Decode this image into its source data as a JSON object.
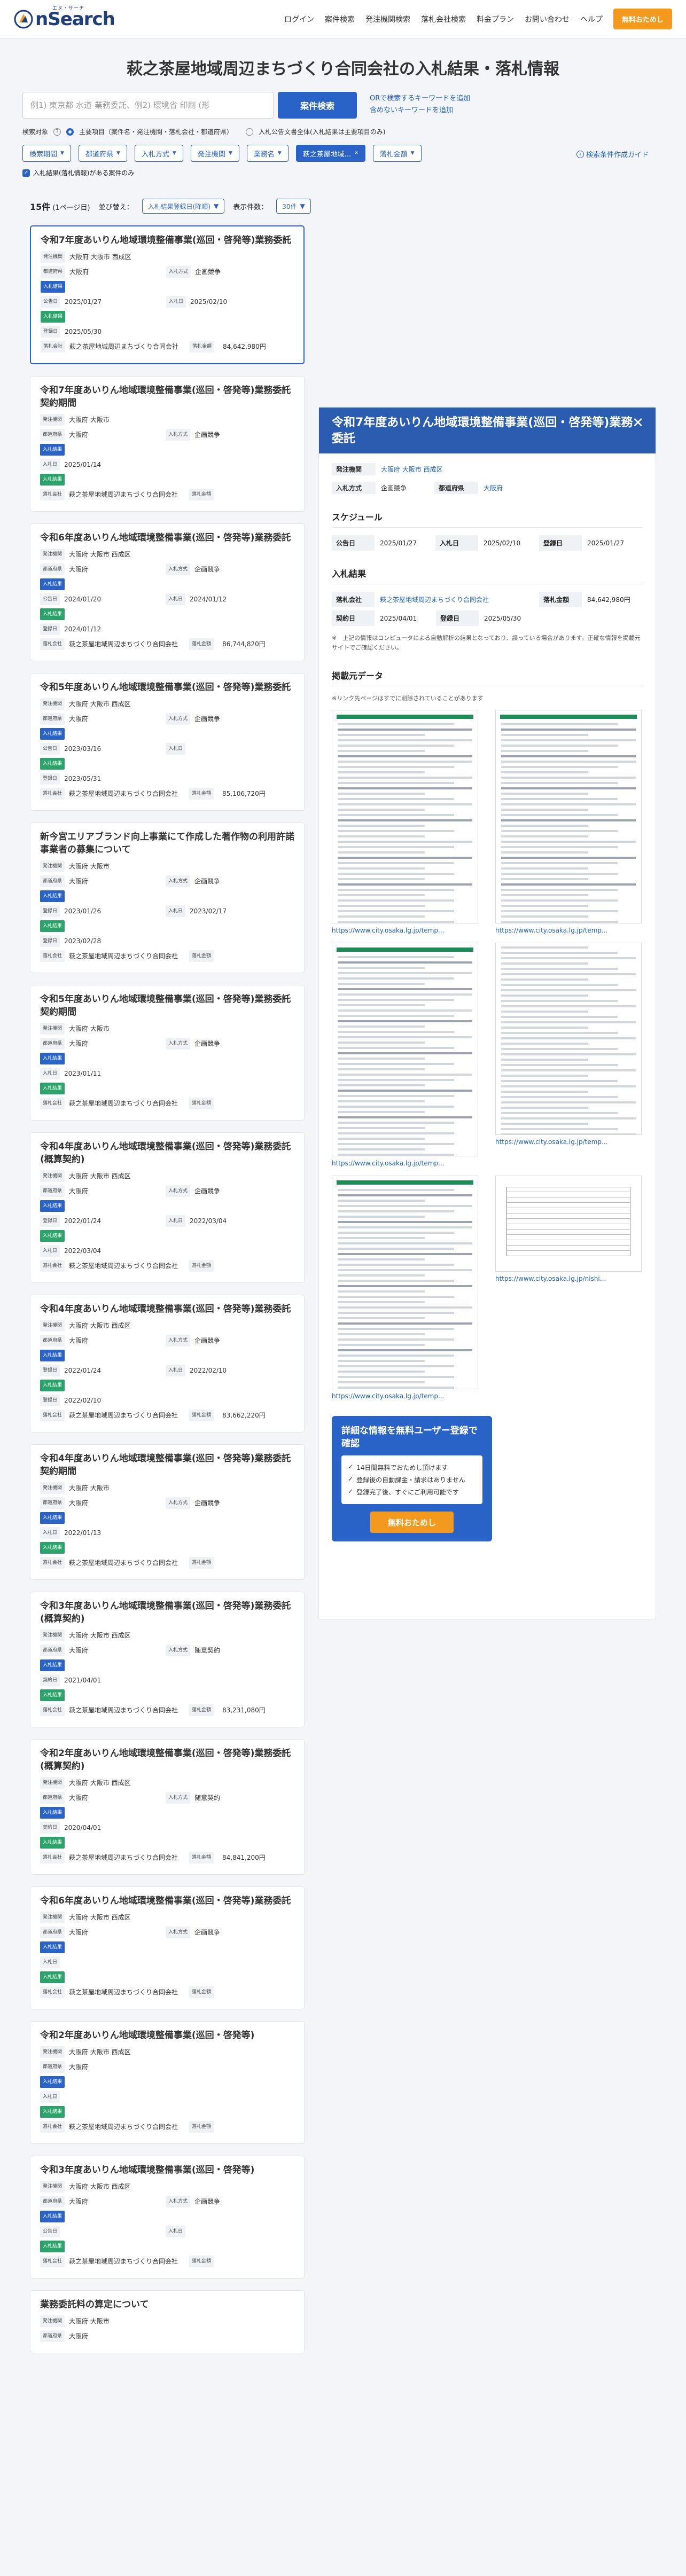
{
  "header": {
    "logo_word": "nSearch",
    "logo_ruby": "エヌ・サーチ",
    "nav": [
      "ログイン",
      "案件検索",
      "発注機関検索",
      "落札会社検索",
      "料金プラン",
      "お問い合わせ",
      "ヘルプ"
    ],
    "cta": "無料おためし"
  },
  "page_title": "萩之茶屋地域周辺まちづくり合同会社の入札結果・落札情報",
  "search": {
    "placeholder": "例1) 東京都 水道 業務委託、例2) 環境省 印刷 (形",
    "button": "案件検索",
    "link1": "ORで検索するキーワードを追加",
    "link2": "含めないキーワードを追加",
    "target_label": "検索対象",
    "target_option": "主要項目（案件名・発注機関・落札会社・都道府県）",
    "target_option2": "入札公告文書全体(入札結果は主要項目のみ)"
  },
  "chips": [
    {
      "label": "検索期間",
      "caret": "▼",
      "active": false
    },
    {
      "label": "都道府県",
      "caret": "▼",
      "active": false
    },
    {
      "label": "入札方式",
      "caret": "▼",
      "active": false
    },
    {
      "label": "発注機関",
      "caret": "▼",
      "active": false
    },
    {
      "label": "業務名",
      "caret": "▼",
      "active": false
    },
    {
      "label": "萩之茶屋地域...",
      "caret": "✕",
      "active": true
    },
    {
      "label": "落札金額",
      "caret": "▼",
      "active": false
    }
  ],
  "guide_link": "検索条件作成ガイド",
  "check_label": "入札結果(落札情報)がある案件のみ",
  "list_head": {
    "count": "15件",
    "pages": "(1ページ目)",
    "sort_label": "並び替え：",
    "sort_value": "入札結果登録日(降順)",
    "per_label": "表示件数：",
    "per_value": "30件"
  },
  "labels": {
    "agency": "発注機関",
    "pref": "都道府県",
    "method": "入札方式",
    "result": "入札結果",
    "notice": "公告日",
    "bid": "入札日",
    "reg": "登録日",
    "contract": "契約日",
    "winner": "落札会社",
    "amount": "落札金額"
  },
  "cards": [
    {
      "title": "令和7年度あいりん地域環境整備事業(巡回・啓発等)業務委託",
      "agency": "大阪府 大阪市 西成区",
      "pref": "大阪府",
      "method": "企画競争",
      "d1l": "公告日",
      "d1": "2025/01/27",
      "d2l": "入札日",
      "d2": "2025/02/10",
      "rl": "登録日",
      "rd": "2025/05/30",
      "winner": "萩之茶屋地域周辺まちづくり合同会社",
      "amount": "84,642,980円"
    },
    {
      "title": "令和7年度あいりん地域環境整備事業(巡回・啓発等)業務委託契約期間",
      "agency": "大阪府 大阪市",
      "pref": "大阪府",
      "method": "企画競争",
      "d1l": "入札日",
      "d1": "2025/01/14",
      "d2l": "",
      "d2": "",
      "rl": "",
      "rd": "",
      "winner": "萩之茶屋地域周辺まちづくり合同会社",
      "amount": ""
    },
    {
      "title": "令和6年度あいりん地域環境整備事業(巡回・啓発等)業務委託",
      "agency": "大阪府 大阪市 西成区",
      "pref": "大阪府",
      "method": "企画競争",
      "d1l": "公告日",
      "d1": "2024/01/20",
      "d2l": "入札日",
      "d2": "2024/01/12",
      "rl": "登録日",
      "rd": "2024/01/12",
      "winner": "萩之茶屋地域周辺まちづくり合同会社",
      "amount": "86,744,820円"
    },
    {
      "title": "令和5年度あいりん地域環境整備事業(巡回・啓発等)業務委託",
      "agency": "大阪府 大阪市 西成区",
      "pref": "大阪府",
      "method": "企画競争",
      "d1l": "公告日",
      "d1": "2023/03/16",
      "d2l": "入札日",
      "d2": "",
      "rl": "登録日",
      "rd": "2023/05/31",
      "winner": "萩之茶屋地域周辺まちづくり合同会社",
      "amount": "85,106,720円"
    },
    {
      "title": "新今宮エリアブランド向上事業にて作成した著作物の利用許諾事業者の募集について",
      "agency": "大阪府 大阪市",
      "pref": "大阪府",
      "method": "企画競争",
      "d1l": "登録日",
      "d1": "2023/01/26",
      "d2l": "入札日",
      "d2": "2023/02/17",
      "rl": "登録日",
      "rd": "2023/02/28",
      "winner": "萩之茶屋地域周辺まちづくり合同会社",
      "amount": ""
    },
    {
      "title": "令和5年度あいりん地域環境整備事業(巡回・啓発等)業務委託契約期間",
      "agency": "大阪府 大阪市",
      "pref": "大阪府",
      "method": "企画競争",
      "d1l": "入札日",
      "d1": "2023/01/11",
      "d2l": "",
      "d2": "",
      "rl": "",
      "rd": "",
      "winner": "萩之茶屋地域周辺まちづくり合同会社",
      "amount": ""
    },
    {
      "title": "令和4年度あいりん地域環境整備事業(巡回・啓発等)業務委託(概算契約)",
      "agency": "大阪府 大阪市 西成区",
      "pref": "大阪府",
      "method": "企画競争",
      "d1l": "登録日",
      "d1": "2022/01/24",
      "d2l": "入札日",
      "d2": "2022/03/04",
      "rl": "入札日",
      "rd": "2022/03/04",
      "winner": "萩之茶屋地域周辺まちづくり合同会社",
      "amount": ""
    },
    {
      "title": "令和4年度あいりん地域環境整備事業(巡回・啓発等)業務委託",
      "agency": "大阪府 大阪市 西成区",
      "pref": "大阪府",
      "method": "企画競争",
      "d1l": "登録日",
      "d1": "2022/01/24",
      "d2l": "入札日",
      "d2": "2022/02/10",
      "rl": "登録日",
      "rd": "2022/02/10",
      "winner": "萩之茶屋地域周辺まちづくり合同会社",
      "amount": "83,662,220円"
    },
    {
      "title": "令和4年度あいりん地域環境整備事業(巡回・啓発等)業務委託契約期間",
      "agency": "大阪府 大阪市",
      "pref": "大阪府",
      "method": "企画競争",
      "d1l": "入札日",
      "d1": "2022/01/13",
      "d2l": "",
      "d2": "",
      "rl": "",
      "rd": "",
      "winner": "萩之茶屋地域周辺まちづくり合同会社",
      "amount": ""
    },
    {
      "title": "令和3年度あいりん地域環境整備事業(巡回・啓発等)業務委託(概算契約)",
      "agency": "大阪府 大阪市 西成区",
      "pref": "大阪府",
      "method": "随意契約",
      "d1l": "契約日",
      "d1": "2021/04/01",
      "d2l": "",
      "d2": "",
      "rl": "",
      "rd": "",
      "winner": "萩之茶屋地域周辺まちづくり合同会社",
      "amount": "83,231,080円"
    },
    {
      "title": "令和2年度あいりん地域環境整備事業(巡回・啓発等)業務委託(概算契約)",
      "agency": "大阪府 大阪市 西成区",
      "pref": "大阪府",
      "method": "随意契約",
      "d1l": "契約日",
      "d1": "2020/04/01",
      "d2l": "",
      "d2": "",
      "rl": "",
      "rd": "",
      "winner": "萩之茶屋地域周辺まちづくり合同会社",
      "amount": "84,841,200円"
    },
    {
      "title": "令和6年度あいりん地域環境整備事業(巡回・啓発等)業務委託",
      "agency": "大阪府 大阪市 西成区",
      "pref": "大阪府",
      "method": "企画競争",
      "d1l": "入札日",
      "d1": "",
      "d2l": "",
      "d2": "",
      "rl": "",
      "rd": "",
      "winner": "萩之茶屋地域周辺まちづくり合同会社",
      "amount": ""
    },
    {
      "title": "令和2年度あいりん地域環境整備事業(巡回・啓発等)",
      "agency": "大阪府 大阪市 西成区",
      "pref": "大阪府",
      "method": "",
      "d1l": "入札日",
      "d1": "",
      "d2l": "",
      "d2": "",
      "rl": "",
      "rd": "",
      "winner": "萩之茶屋地域周辺まちづくり合同会社",
      "amount": ""
    },
    {
      "title": "令和3年度あいりん地域環境整備事業(巡回・啓発等)",
      "agency": "大阪府 大阪市 西成区",
      "pref": "大阪府",
      "method": "企画競争",
      "d1l": "公告日",
      "d1": "",
      "d2l": "入札日",
      "d2": "",
      "rl": "",
      "rd": "",
      "winner": "萩之茶屋地域周辺まちづくり合同会社",
      "amount": ""
    },
    {
      "title": "業務委託料の算定について",
      "agency": "大阪府 大阪市",
      "pref": "大阪府",
      "method": "",
      "d1l": "",
      "d1": "",
      "d2l": "",
      "d2": "",
      "rl": "",
      "rd": "",
      "winner": "",
      "amount": ""
    }
  ],
  "detail": {
    "title": "令和7年度あいりん地域環境整備事業(巡回・啓発等)業務委託",
    "close": "✕",
    "agency_label": "発注機関",
    "agency": "大阪府 大阪市 西成区",
    "method_label": "入札方式",
    "method": "企画競争",
    "pref_label": "都道府県",
    "pref": "大阪府",
    "schedule_title": "スケジュール",
    "notice_label": "公告日",
    "notice": "2025/01/27",
    "bid_label": "入札日",
    "bid": "2025/02/10",
    "reg_label": "登録日",
    "reg": "2025/01/27",
    "result_title": "入札結果",
    "winner_label": "落札会社",
    "winner": "萩之茶屋地域周辺まちづくり合同会社",
    "amount_label": "落札金額",
    "amount": "84,642,980円",
    "contract_label": "契約日",
    "contract": "2025/04/01",
    "reg2_label": "登録日",
    "reg2": "2025/05/30",
    "note": "※　上記の情報はコンピュータによる自動解析の結果となっており、誤っている場合があります。正確な情報を掲載元サイトでご確認ください。",
    "docs_title": "掲載元データ",
    "docs_note": "※リンク先ページはすでに削除されていることがあります",
    "docs": [
      "https://www.city.osaka.lg.jp/temp...",
      "https://www.city.osaka.lg.jp/temp...",
      "https://www.city.osaka.lg.jp/temp...",
      "https://www.city.osaka.lg.jp/temp...",
      "https://www.city.osaka.lg.jp/temp...",
      "https://www.city.osaka.lg.jp/nishi..."
    ]
  },
  "promo": {
    "title": "詳細な情報を無料ユーザー登録で確認",
    "items": [
      "14日間無料でおためし頂けます",
      "登録後の自動課金・請求はありません",
      "登録完了後、すぐにご利用可能です"
    ],
    "button": "無料おためし"
  }
}
